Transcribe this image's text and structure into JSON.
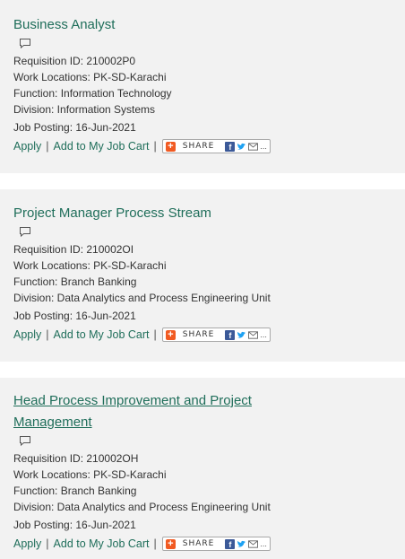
{
  "jobs": [
    {
      "title": "Business Analyst",
      "requisition": "Requisition ID: 210002P0",
      "locations": "Work Locations: PK-SD-Karachi",
      "function": "Function: Information Technology",
      "division": "Division: Information Systems",
      "posting": "Job Posting: 16-Jun-2021"
    },
    {
      "title": "Project Manager Process Stream",
      "requisition": "Requisition ID: 210002OI",
      "locations": "Work Locations: PK-SD-Karachi",
      "function": "Function: Branch Banking",
      "division": "Division: Data Analytics and Process Engineering Unit",
      "posting": "Job Posting: 16-Jun-2021"
    },
    {
      "title": "Head Process Improvement and Project Management",
      "requisition": "Requisition ID: 210002OH",
      "locations": "Work Locations: PK-SD-Karachi",
      "function": "Function: Branch Banking",
      "division": "Division: Data Analytics and Process Engineering Unit",
      "posting": "Job Posting: 16-Jun-2021"
    }
  ],
  "actions": {
    "apply": "Apply",
    "separator": "|",
    "add_to_cart": "Add to My Job Cart",
    "share": "SHARE",
    "more": "..."
  },
  "icons": {
    "comment": "comment-icon",
    "share_plus": "share-plus-icon",
    "facebook": "facebook-icon",
    "twitter": "twitter-icon",
    "email": "email-icon"
  },
  "colors": {
    "link": "#1f6e5a",
    "card_background": "#f2f2f2",
    "share_orange": "#f15a22",
    "facebook_blue": "#3b5998",
    "twitter_blue": "#1da1f2"
  }
}
